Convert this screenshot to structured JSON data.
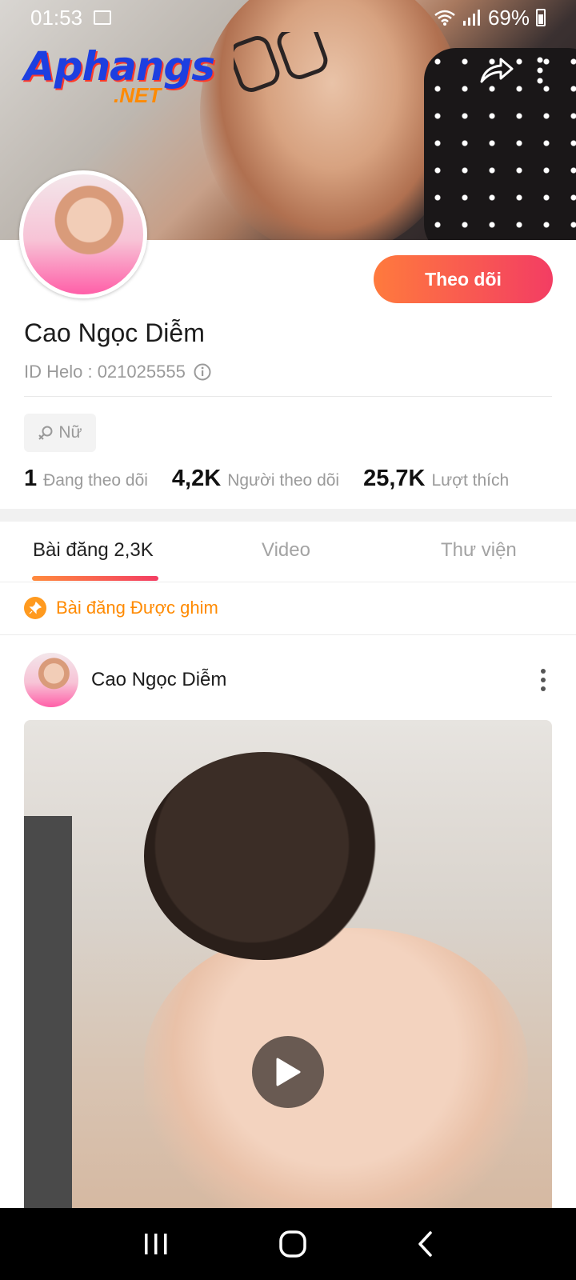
{
  "status_bar": {
    "time": "01:53",
    "battery": "69%"
  },
  "watermark": {
    "brand": "Aphangs",
    "suffix": ".NET"
  },
  "profile": {
    "name": "Cao Ngọc Diễm",
    "id_label": "ID Helo : 021025555",
    "gender": "Nữ",
    "follow_button": "Theo dõi",
    "stats": [
      {
        "value": "1",
        "label": "Đang theo dõi"
      },
      {
        "value": "4,2K",
        "label": "Người theo dõi"
      },
      {
        "value": "25,7K",
        "label": "Lượt thích"
      }
    ]
  },
  "tabs": [
    {
      "label": "Bài đăng 2,3K",
      "active": true
    },
    {
      "label": "Video",
      "active": false
    },
    {
      "label": "Thư viện",
      "active": false
    }
  ],
  "pinned_label": "Bài đăng Được ghim",
  "post": {
    "author": "Cao Ngọc Diễm"
  },
  "colors": {
    "accent_start": "#ff7a3d",
    "accent_end": "#f33d63",
    "pinned": "#ff8a00"
  }
}
